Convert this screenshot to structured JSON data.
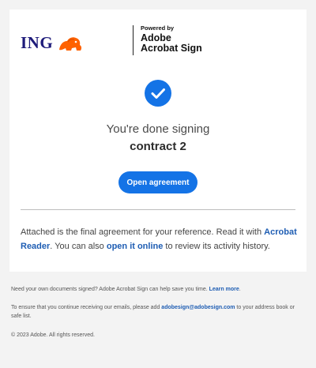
{
  "brand": {
    "bank_name": "ING"
  },
  "powered_by": {
    "line1": "Powered by",
    "line2": "Adobe",
    "line3": "Acrobat Sign"
  },
  "status": {
    "done_text": "You're done signing",
    "document_name": "contract 2"
  },
  "open_button_label": "Open agreement",
  "message": {
    "part1": "Attached is the final agreement for your reference. Read it with ",
    "reader_link": "Acrobat Reader",
    "part2": ". You can also ",
    "online_link": "open it online",
    "part3": " to review its activity history."
  },
  "footer": {
    "own_docs": "Need your own documents signed? Adobe Acrobat Sign can help save you time. ",
    "learn_more": "Learn more",
    "learn_more_tail": ".",
    "receive_prefix": "To ensure that you continue receiving our emails, please add ",
    "email": "adobesign@adobesign.com",
    "receive_suffix": " to your address book or safe list.",
    "copyright": "© 2023 Adobe. All rights reserved."
  },
  "colors": {
    "accent": "#1473e6",
    "ing_blue": "#1e1b7a",
    "ing_orange": "#ff6200",
    "link": "#1e5db3"
  },
  "icons": {
    "check": "checkmark-circle-icon",
    "lion": "ing-lion-icon"
  }
}
